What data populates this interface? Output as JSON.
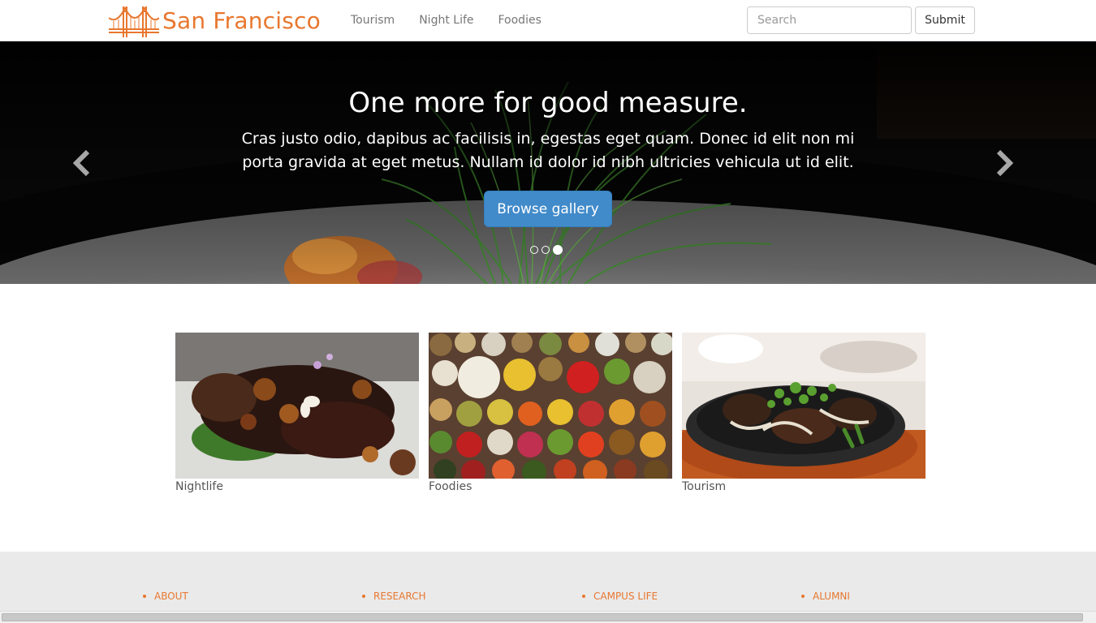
{
  "navbar": {
    "brand": "San Francisco",
    "brand_color": "#e8772e",
    "links": [
      "Tourism",
      "Night Life",
      "Foodies"
    ],
    "search_placeholder": "Search",
    "submit_label": "Submit"
  },
  "carousel": {
    "title": "One more for good measure.",
    "text": "Cras justo odio, dapibus ac facilisis in, egestas eget quam. Donec id elit non mi porta gravida at eget metus. Nullam id dolor id nibh ultricies vehicula ut id elit.",
    "button_label": "Browse gallery",
    "button_color": "#428bca",
    "slide_count": 3,
    "active_slide": 3,
    "prev_icon": "chevron-left-icon",
    "next_icon": "chevron-right-icon"
  },
  "thumbnails": [
    {
      "label": "Nightlife"
    },
    {
      "label": "Foodies"
    },
    {
      "label": "Tourism"
    }
  ],
  "footer": {
    "items": [
      "ABOUT",
      "RESEARCH",
      "CAMPUS LIFE",
      "ALUMNI"
    ],
    "background": "#eaeaea"
  }
}
